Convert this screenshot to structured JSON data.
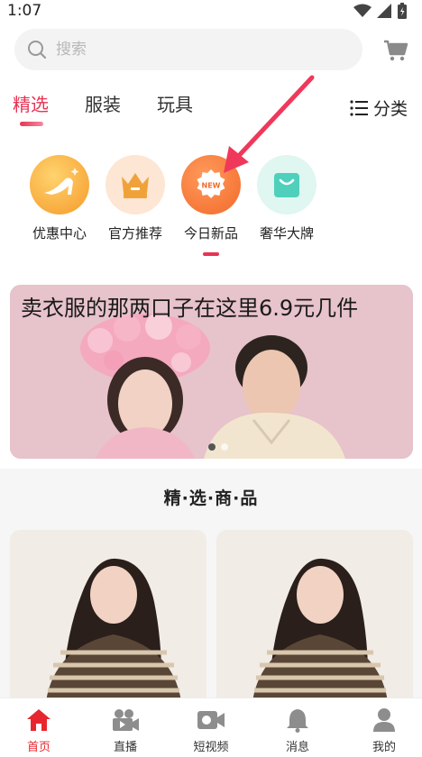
{
  "status": {
    "time": "1:07"
  },
  "search": {
    "placeholder": "搜索"
  },
  "tabs": [
    {
      "label": "精选",
      "active": true
    },
    {
      "label": "服装",
      "active": false
    },
    {
      "label": "玩具",
      "active": false
    }
  ],
  "category_label": "分类",
  "quick_entries": [
    {
      "label": "优惠中心",
      "icon": "high-heel-icon"
    },
    {
      "label": "官方推荐",
      "icon": "crown-icon"
    },
    {
      "label": "今日新品",
      "icon": "new-badge-icon",
      "badge": "NEW"
    },
    {
      "label": "奢华大牌",
      "icon": "shopping-bag-icon"
    }
  ],
  "banner": {
    "title": "卖衣服的那两口子在这里6.9元几件",
    "slides": 2,
    "current_slide": 1
  },
  "section": {
    "title": "精·选·商·品"
  },
  "bottom_nav": [
    {
      "label": "首页",
      "icon": "home-icon",
      "active": true
    },
    {
      "label": "直播",
      "icon": "live-camera-icon",
      "active": false
    },
    {
      "label": "短视频",
      "icon": "video-icon",
      "active": false
    },
    {
      "label": "消息",
      "icon": "bell-icon",
      "active": false
    },
    {
      "label": "我的",
      "icon": "user-icon",
      "active": false
    }
  ],
  "colors": {
    "accent": "#e83354",
    "nav_active": "#e8262f",
    "orange": "#f79a2c",
    "mint": "#56d5c4"
  }
}
